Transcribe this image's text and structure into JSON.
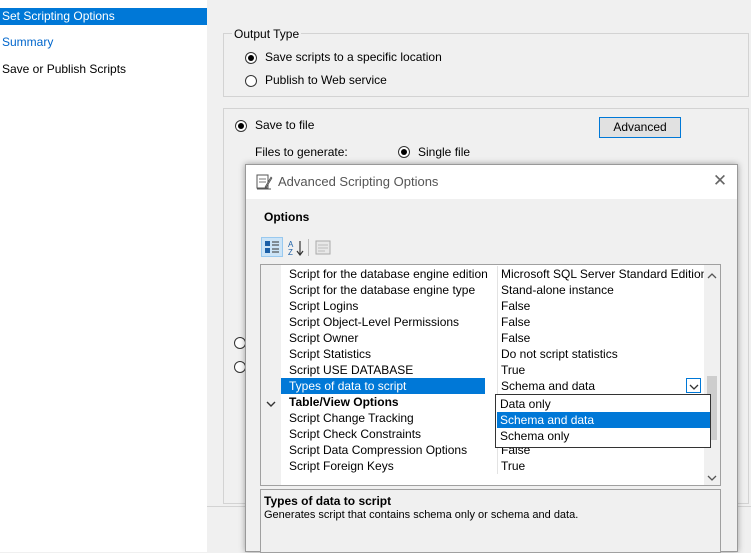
{
  "nav": {
    "items": [
      {
        "label": "Set Scripting Options"
      },
      {
        "label": "Summary"
      },
      {
        "label": "Save or Publish Scripts"
      }
    ]
  },
  "output": {
    "group_label": "Output Type",
    "options": [
      "Save scripts to a specific location",
      "Publish to Web service"
    ]
  },
  "save": {
    "save_to_file": "Save to file",
    "advanced_button": "Advanced",
    "files_to_generate": "Files to generate:",
    "single_file": "Single file"
  },
  "dialog": {
    "title": "Advanced Scripting Options",
    "options_header": "Options",
    "rows": [
      {
        "name": "Script for the database engine edition",
        "value": "Microsoft SQL Server Standard Edition"
      },
      {
        "name": "Script for the database engine type",
        "value": "Stand-alone instance"
      },
      {
        "name": "Script Logins",
        "value": "False"
      },
      {
        "name": "Script Object-Level Permissions",
        "value": "False"
      },
      {
        "name": "Script Owner",
        "value": "False"
      },
      {
        "name": "Script Statistics",
        "value": "Do not script statistics"
      },
      {
        "name": "Script USE DATABASE",
        "value": "True"
      },
      {
        "name": "Types of data to script",
        "value": "Schema and data"
      }
    ],
    "category": "Table/View Options",
    "rows2": [
      {
        "name": "Script Change Tracking",
        "value": ""
      },
      {
        "name": "Script Check Constraints",
        "value": ""
      },
      {
        "name": "Script Data Compression Options",
        "value": "False"
      },
      {
        "name": "Script Foreign Keys",
        "value": "True"
      }
    ],
    "dropdown": [
      "Data only",
      "Schema and data",
      "Schema only"
    ],
    "desc_title": "Types of data to script",
    "desc_text": "Generates script that contains schema only or schema and data."
  }
}
